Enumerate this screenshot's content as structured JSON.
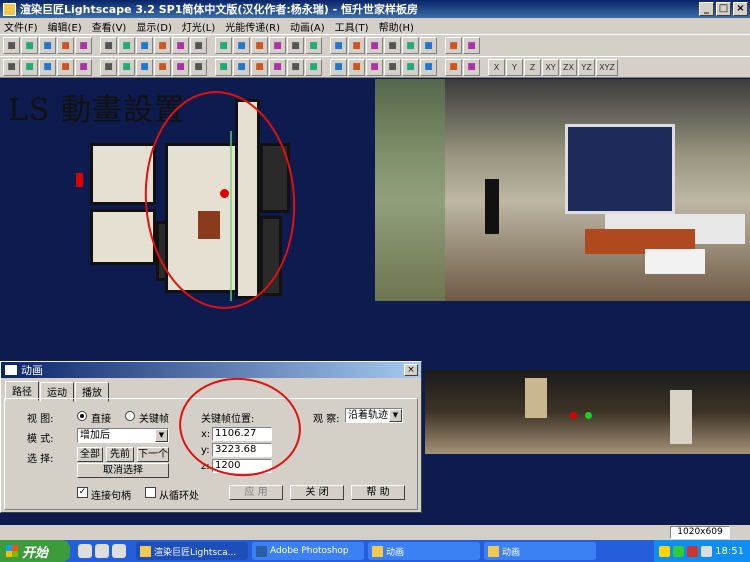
{
  "window": {
    "title": "渲染巨匠Lightscape 3.2 SP1简体中文版(汉化作者:杨永瑞) - 恒升世家样板房",
    "min": "_",
    "max": "□",
    "close": "×"
  },
  "menu": [
    "文件(F)",
    "编辑(E)",
    "查看(V)",
    "显示(D)",
    "灯光(L)",
    "光能传递(R)",
    "动画(A)",
    "工具(T)",
    "帮助(H)"
  ],
  "toolbar_icons": {
    "row1": [
      "new-icon",
      "open-icon",
      "save-icon",
      "undo-icon",
      "print-icon",
      "help-icon",
      "question-icon",
      "select-icon",
      "move-icon",
      "rotate-icon",
      "scale-icon",
      "copy-icon",
      "paste-icon",
      "layer-icon",
      "link-icon",
      "surface-icon",
      "camera-icon",
      "light-icon",
      "pointer-icon",
      "target-icon",
      "add-icon",
      "remove-icon",
      "person-icon",
      "walk-icon",
      "run-icon"
    ],
    "row2": [
      "navigate-icon",
      "eye-icon",
      "zoom-icon",
      "zoom-region-icon",
      "pan-icon",
      "orbit-icon",
      "fit-icon",
      "wire-icon",
      "solid-icon",
      "shade-icon",
      "texture-icon",
      "render-icon",
      "process-icon",
      "block-icon",
      "cube-icon",
      "filter-icon",
      "materials-icon",
      "globe-icon",
      "ray-icon",
      "sun-icon",
      "lamp-icon",
      "cube2-icon",
      "lightbulb-icon",
      "grid-icon",
      "axis-icon"
    ]
  },
  "axis_buttons": [
    "X",
    "Y",
    "Z",
    "XY",
    "ZX",
    "YZ",
    "XYZ"
  ],
  "overlay_text": "LS 動畫設置",
  "dialog": {
    "title": "动画",
    "close": "×",
    "tabs": [
      "路径",
      "运动",
      "播放"
    ],
    "view_label": "视 图:",
    "view_options": [
      "直接",
      "关键帧"
    ],
    "mode_label": "模 式:",
    "mode_value": "增加后",
    "select_label": "选 择:",
    "buttons": {
      "all": "全部",
      "prev": "先前",
      "next": "下一个",
      "deselect": "取消选择"
    },
    "keyframe_label": "关键帧位置:",
    "x_label": "x:",
    "x_value": "1106.27",
    "y_label": "y:",
    "y_value": "3223.68",
    "z_label": "z:",
    "z_value": "1200",
    "observe_label": "观 察:",
    "observe_value": "沿着轨迹",
    "connect_label": "连接句柄",
    "loop_label": "从循环处",
    "apply": "应 用",
    "close_btn": "关 闭",
    "help": "帮 助"
  },
  "status": {
    "resolution": "1020x609"
  },
  "taskbar": {
    "start": "开始",
    "tasks": [
      "渲染巨匠Lightsca...",
      "Adobe Photoshop",
      "动画",
      "动画"
    ],
    "clock": "18:51"
  }
}
